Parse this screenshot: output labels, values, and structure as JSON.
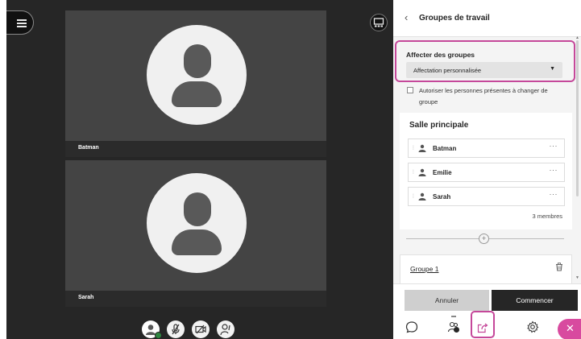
{
  "video": {
    "participants": [
      {
        "name": "Batman"
      },
      {
        "name": "Sarah"
      }
    ]
  },
  "panel": {
    "title": "Groupes de travail",
    "assign": {
      "label": "Affecter des groupes",
      "selected": "Affectation personnalisée"
    },
    "allow_switch_label": "Autoriser les personnes présentes à changer de groupe",
    "main_room": {
      "title": "Salle principale",
      "members": [
        {
          "name": "Batman"
        },
        {
          "name": "Emilie"
        },
        {
          "name": "Sarah"
        }
      ],
      "count_label": "3 membres"
    },
    "groups": [
      {
        "name": "Groupe 1"
      }
    ],
    "buttons": {
      "cancel": "Annuler",
      "start": "Commencer"
    }
  },
  "colors": {
    "accent": "#c5489a",
    "close_button": "#d84a9f",
    "dark": "#262626"
  },
  "icons": {
    "menu": "hamburger-icon",
    "layout": "layout-icon",
    "back": "chevron-left-icon",
    "chat": "chat-icon",
    "participants": "participants-icon",
    "share": "share-content-icon",
    "settings": "gear-icon",
    "close": "close-icon"
  }
}
